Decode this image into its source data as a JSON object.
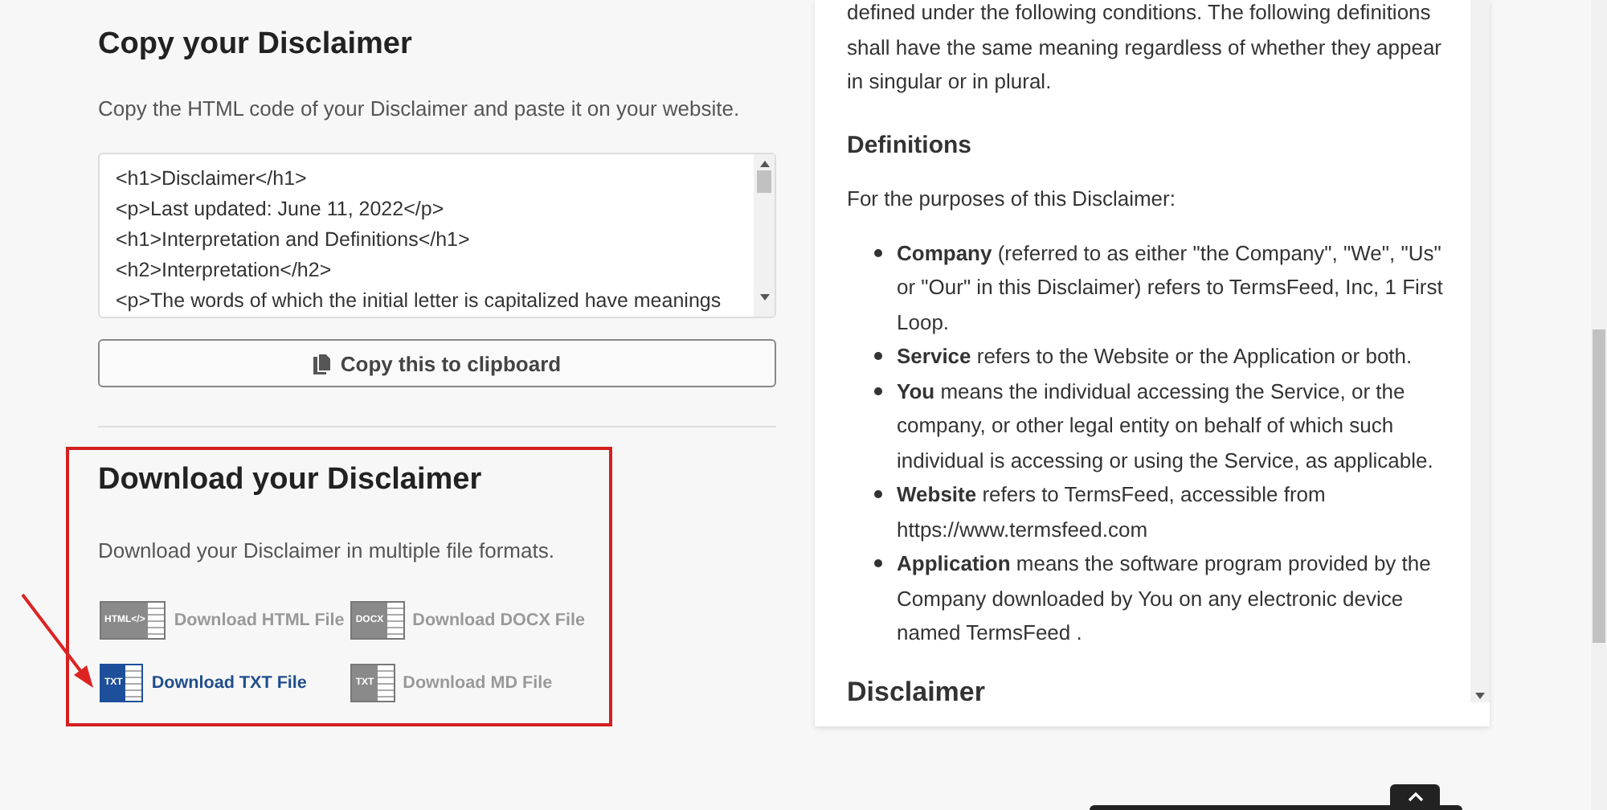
{
  "copy_section": {
    "title": "Copy your Disclaimer",
    "description": "Copy the HTML code of your Disclaimer and paste it on your website.",
    "code_lines": [
      "<h1>Disclaimer</h1>",
      "<p>Last updated: June 11, 2022</p>",
      "<h1>Interpretation and Definitions</h1>",
      "<h2>Interpretation</h2>",
      "<p>The words of which the initial letter is capitalized have meanings"
    ],
    "copy_button": "Copy this to clipboard"
  },
  "download_section": {
    "title": "Download your Disclaimer",
    "description": "Download your Disclaimer in multiple file formats.",
    "downloads": [
      {
        "label": "Download HTML File",
        "icon_text": "HTML</>",
        "selected": false
      },
      {
        "label": "Download DOCX File",
        "icon_text": "DOCX",
        "selected": false
      },
      {
        "label": "Download TXT File",
        "icon_text": "TXT",
        "selected": true
      },
      {
        "label": "Download MD File",
        "icon_text": "TXT",
        "selected": false
      }
    ]
  },
  "preview": {
    "paragraph": "defined under the following conditions. The following definitions shall have the same meaning regardless of whether they appear in singular or in plural.",
    "heading": "Definitions",
    "intro": "For the purposes of this Disclaimer:",
    "items": [
      {
        "term": "Company",
        "text": "(referred to as either \"the Company\", \"We\", \"Us\" or \"Our\" in this Disclaimer) refers to TermsFeed, Inc, 1 First Loop."
      },
      {
        "term": "Service",
        "text": "refers to the Website or the Application or both."
      },
      {
        "term": "You",
        "text": "means the individual accessing the Service, or the company, or other legal entity on behalf of which such individual is accessing or using the Service, as applicable."
      },
      {
        "term": "Website",
        "text": "refers to TermsFeed, accessible from https://www.termsfeed.com"
      },
      {
        "term": "Application",
        "text": "means the software program provided by the Company downloaded by You on any electronic device named TermsFeed ."
      }
    ],
    "next_heading": "Disclaimer"
  }
}
